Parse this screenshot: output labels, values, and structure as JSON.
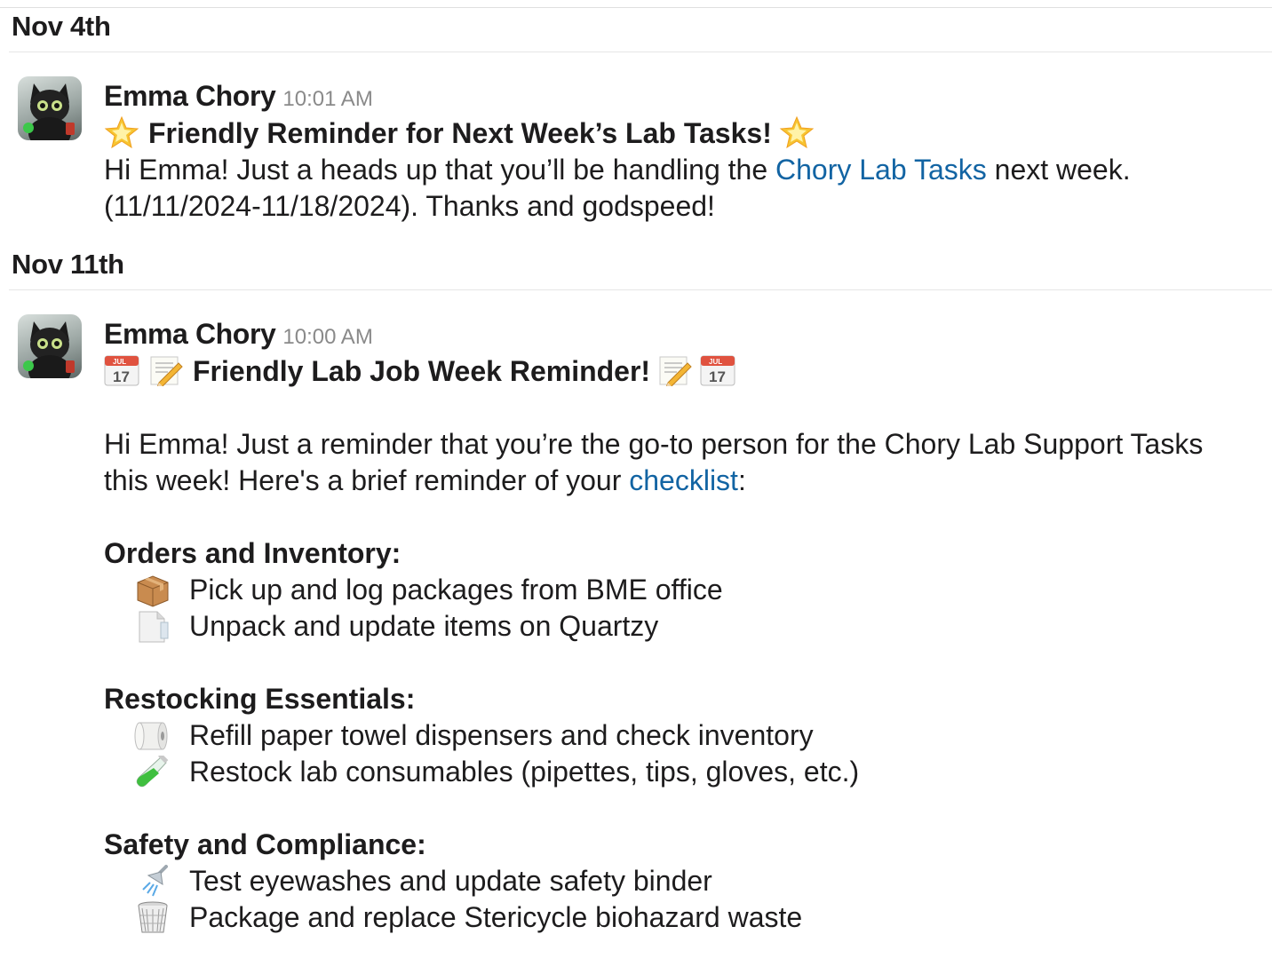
{
  "days": [
    {
      "date": "Nov 4th",
      "message": {
        "author": "Emma Chory",
        "time": "10:01 AM",
        "title": "Friendly Reminder for Next Week’s Lab Tasks!",
        "title_icons": [
          "star-icon",
          "star-icon"
        ],
        "body_prefix": "Hi Emma! Just a heads up that you’ll be handling the ",
        "body_link": "Chory Lab Tasks",
        "body_suffix": " next week.",
        "body_line2": "(11/11/2024-11/18/2024). Thanks and godspeed!"
      }
    },
    {
      "date": "Nov 11th",
      "message": {
        "author": "Emma Chory",
        "time": "10:00 AM",
        "title": "Friendly Lab Job Week Reminder!",
        "calendar_month": "JUL",
        "calendar_day": "17",
        "title_icons": [
          "calendar-icon",
          "memo-pencil-icon",
          "memo-pencil-icon",
          "calendar-icon"
        ],
        "intro_line1": "Hi Emma! Just a reminder that you’re the go-to person for the Chory Lab Support Tasks",
        "intro_line2_prefix": "this week! Here's a brief reminder of your ",
        "intro_link": "checklist",
        "intro_line2_suffix": ":",
        "sections": [
          {
            "heading": "Orders and Inventory:",
            "items": [
              {
                "icon": "package-icon",
                "text": "Pick up and log packages from BME office"
              },
              {
                "icon": "page-icon",
                "text": "Unpack and update items on Quartzy"
              }
            ]
          },
          {
            "heading": "Restocking Essentials:",
            "items": [
              {
                "icon": "paper-roll-icon",
                "text": "Refill paper towel dispensers and check inventory"
              },
              {
                "icon": "test-tube-icon",
                "text": "Restock lab consumables (pipettes, tips, gloves, etc.)"
              }
            ]
          },
          {
            "heading": "Safety and Compliance:",
            "items": [
              {
                "icon": "shower-icon",
                "text": "Test eyewashes and update safety binder"
              },
              {
                "icon": "wastebasket-icon",
                "text": "Package and replace Stericycle biohazard waste"
              }
            ]
          }
        ]
      }
    }
  ],
  "colors": {
    "link": "#1264a3",
    "text": "#1d1c1d",
    "timestamp": "#8a8a8a"
  }
}
